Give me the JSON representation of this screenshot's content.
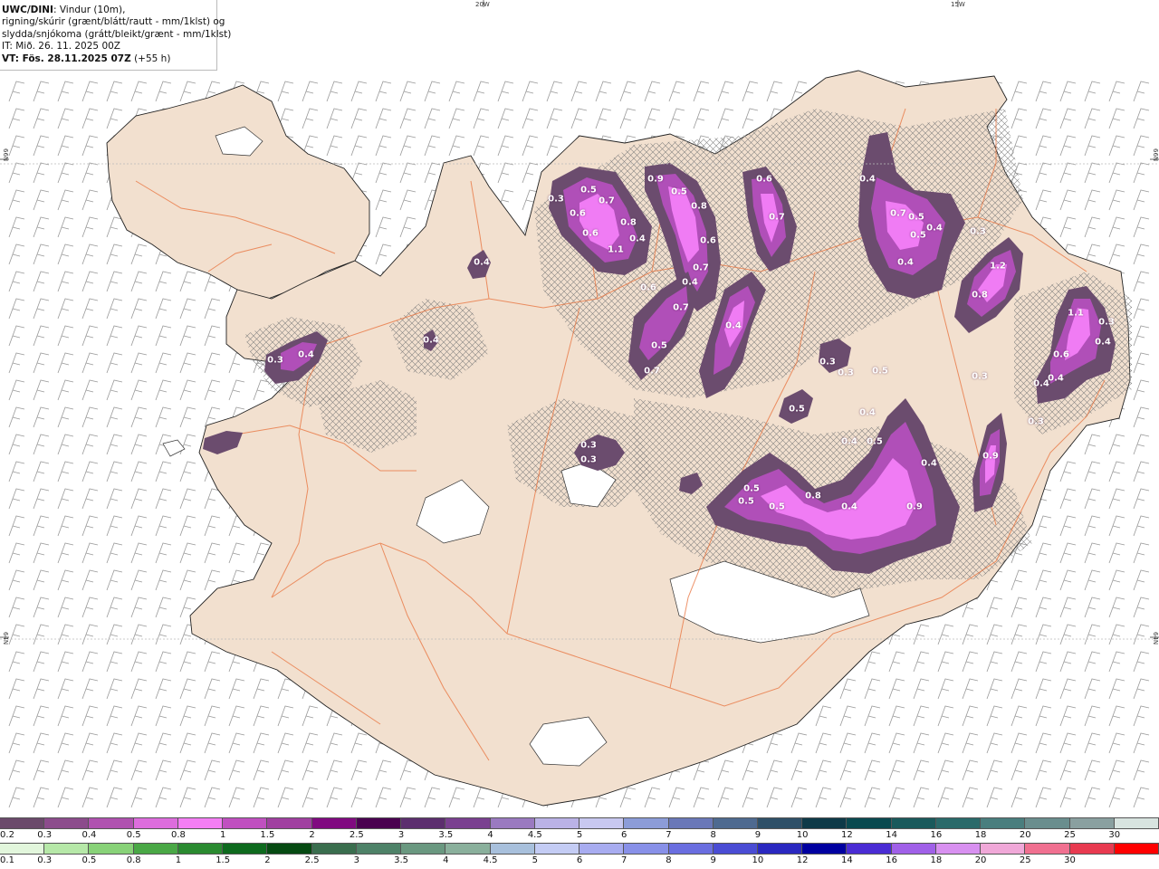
{
  "info": {
    "model": "UWC/DINI",
    "desc_line1": ": Vindur (10m),",
    "desc_line2": "rigning/skúrir (grænt/blátt/rautt - mm/1klst) og",
    "desc_line3": "slydda/snjókoma (grátt/bleikt/grænt - mm/1klst)",
    "it_line": "IT: Mið. 26. 11. 2025 00Z",
    "vt_line": "VT: Fös. 28.11.2025 07Z",
    "vt_lead": " (+55 h)"
  },
  "coords": {
    "top_20w": "20W",
    "top_15w": "15W",
    "left_66n": "66N",
    "left_64n": "64N",
    "right_66n": "66N",
    "right_64n": "64N"
  },
  "colors": {
    "land": "#f2e0cf",
    "sea": "#ffffff",
    "glacier": "#ffffff",
    "roads": "#e8703a",
    "precip_low": "#6b4c6e",
    "precip_mid": "#b04fb8",
    "precip_high": "#f07cf4",
    "wind_barb": "#9a9a9a",
    "hatch": "#777777"
  },
  "precip_labels": [
    {
      "v": "0.3"
    },
    {
      "v": "0.5"
    },
    {
      "v": "0.7"
    },
    {
      "v": "0.6"
    },
    {
      "v": "0.8"
    },
    {
      "v": "1.1"
    },
    {
      "v": "0.6"
    },
    {
      "v": "0.4"
    },
    {
      "v": "0.6"
    },
    {
      "v": "0.9"
    },
    {
      "v": "0.5"
    },
    {
      "v": "0.8"
    },
    {
      "v": "0.6"
    },
    {
      "v": "0.7"
    },
    {
      "v": "0.4"
    },
    {
      "v": "0.7"
    },
    {
      "v": "0.5"
    },
    {
      "v": "0.7"
    },
    {
      "v": "0.4"
    },
    {
      "v": "0.6"
    },
    {
      "v": "0.7"
    },
    {
      "v": "0.4"
    },
    {
      "v": "0.7"
    },
    {
      "v": "0.5"
    },
    {
      "v": "0.5"
    },
    {
      "v": "0.4"
    },
    {
      "v": "0.3"
    },
    {
      "v": "0.4"
    },
    {
      "v": "1.2"
    },
    {
      "v": "0.8"
    },
    {
      "v": "1.1"
    },
    {
      "v": "0.3"
    },
    {
      "v": "0.4"
    },
    {
      "v": "0.6"
    },
    {
      "v": "0.4"
    },
    {
      "v": "0.4"
    },
    {
      "v": "0.3"
    },
    {
      "v": "0.3"
    },
    {
      "v": "0.3"
    },
    {
      "v": "0.5"
    },
    {
      "v": "0.4"
    },
    {
      "v": "0.5"
    },
    {
      "v": "0.4"
    },
    {
      "v": "0.5"
    },
    {
      "v": "0.5"
    },
    {
      "v": "0.5"
    },
    {
      "v": "0.5"
    },
    {
      "v": "0.8"
    },
    {
      "v": "0.4"
    },
    {
      "v": "0.9"
    },
    {
      "v": "0.9"
    },
    {
      "v": "0.4"
    },
    {
      "v": "0.3"
    },
    {
      "v": "0.3"
    },
    {
      "v": "0.3"
    },
    {
      "v": "0.4"
    },
    {
      "v": "0.4"
    },
    {
      "v": "0.3"
    },
    {
      "v": "0.4"
    }
  ],
  "legend": {
    "snow_labels": [
      "0.2",
      "0.3",
      "0.4",
      "0.5",
      "0.8",
      "1",
      "1.5",
      "2",
      "2.5",
      "3",
      "3.5",
      "4",
      "4.5",
      "5",
      "6",
      "7",
      "8",
      "9",
      "10",
      "12",
      "14",
      "16",
      "18",
      "20",
      "25",
      "30"
    ],
    "snow_colors": [
      "#6b4a6b",
      "#8c4c8c",
      "#b052b0",
      "#dd6ddd",
      "#f47ef4",
      "#c050c0",
      "#a040a0",
      "#800a80",
      "#4a0050",
      "#5c2e6e",
      "#7a4090",
      "#9a7ac0",
      "#bab2e6",
      "#c8c8f0",
      "#8c9cd8",
      "#6a78b8",
      "#4e6a90",
      "#2e5068",
      "#0e3a48",
      "#0a4a50",
      "#1a5a5c",
      "#2a6a6a",
      "#4a7e7e",
      "#6a8e8e",
      "#8aa0a0",
      "#d8e4e0"
    ],
    "rain_labels": [
      "0.1",
      "0.3",
      "0.5",
      "0.8",
      "1",
      "1.5",
      "2",
      "2.5",
      "3",
      "3.5",
      "4",
      "4.5",
      "5",
      "6",
      "7",
      "8",
      "9",
      "10",
      "12",
      "14",
      "16",
      "18",
      "20",
      "25",
      "30"
    ],
    "rain_colors": [
      "#e2f6dc",
      "#b6e8a8",
      "#88d278",
      "#4aa846",
      "#2a8a30",
      "#0e6a1e",
      "#064a12",
      "#3a6e4e",
      "#4e8268",
      "#6a9880",
      "#8ab09c",
      "#a8c0dc",
      "#c4ccf4",
      "#a8acf0",
      "#8890e8",
      "#6a6ee0",
      "#4a4cd4",
      "#2a28c0",
      "#0000a0",
      "#4a2cd4",
      "#a060e8",
      "#d890f0",
      "#f0a8d8",
      "#f07090",
      "#e83a50",
      "#ff0000"
    ]
  }
}
